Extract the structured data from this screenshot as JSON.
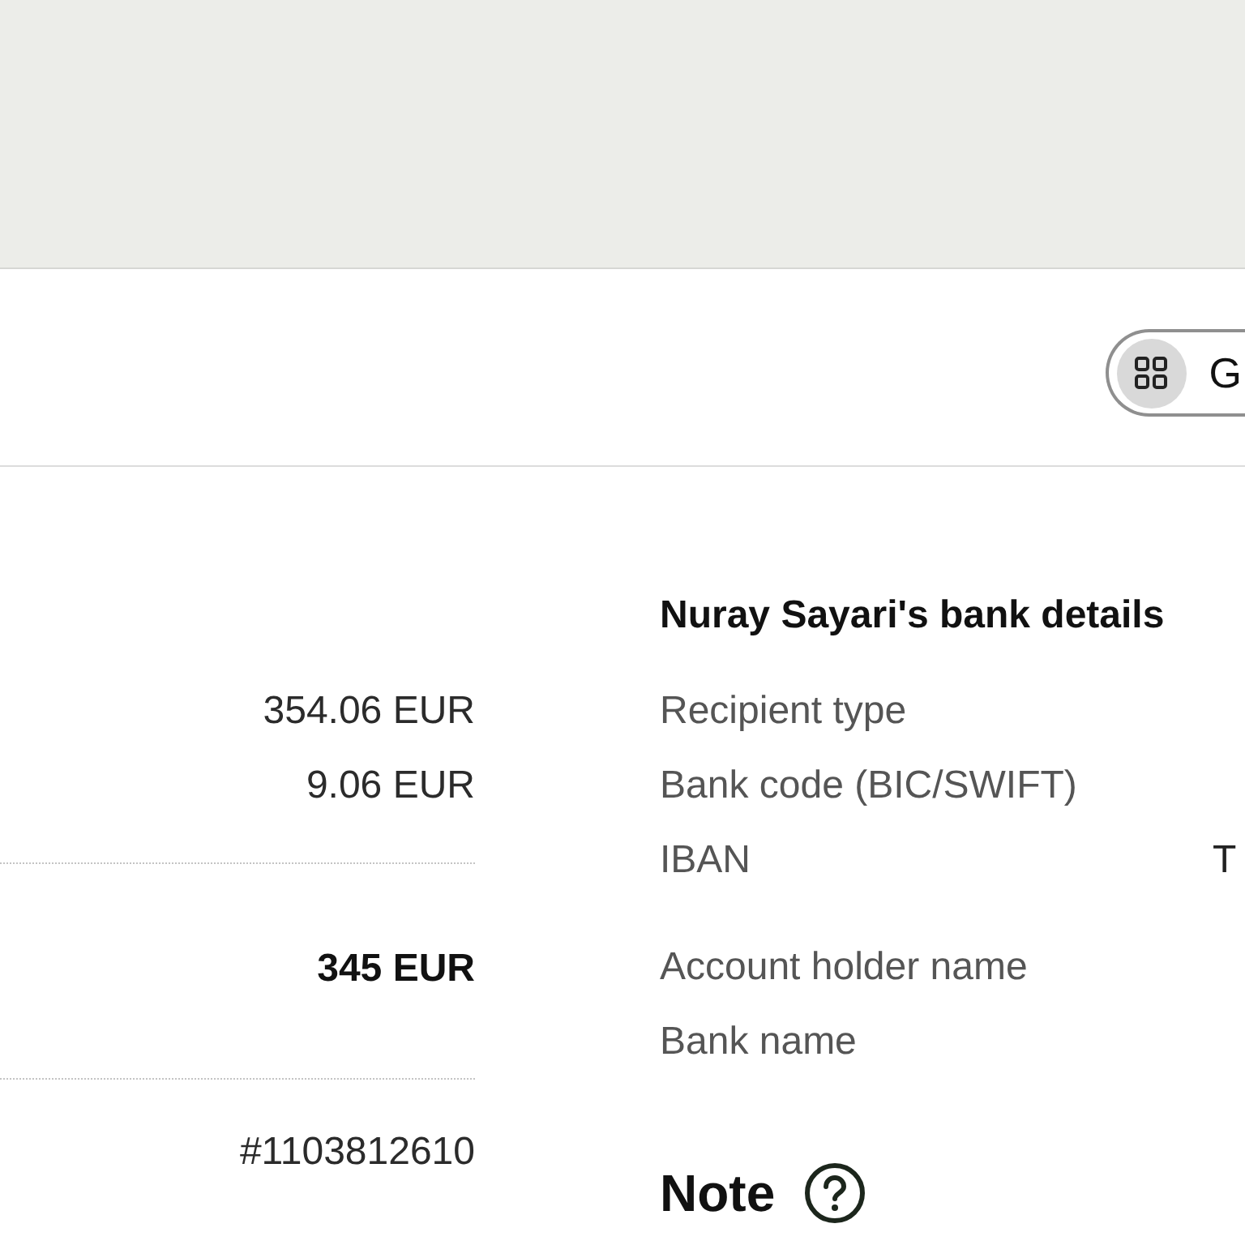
{
  "toolbar": {
    "view_button": {
      "label": "G"
    }
  },
  "summary": {
    "amounts": [
      "354.06 EUR",
      "9.06 EUR"
    ],
    "total": "345 EUR",
    "reference": "#1103812610"
  },
  "bank_details": {
    "title": "Nuray Sayari's bank details",
    "field_groups": [
      {
        "fields": [
          {
            "label": "Recipient type"
          },
          {
            "label": "Bank code (BIC/SWIFT)"
          },
          {
            "label": "IBAN",
            "value": "T"
          }
        ]
      },
      {
        "fields": [
          {
            "label": "Account holder name"
          },
          {
            "label": "Bank name"
          }
        ]
      }
    ]
  },
  "note": {
    "title": "Note"
  }
}
